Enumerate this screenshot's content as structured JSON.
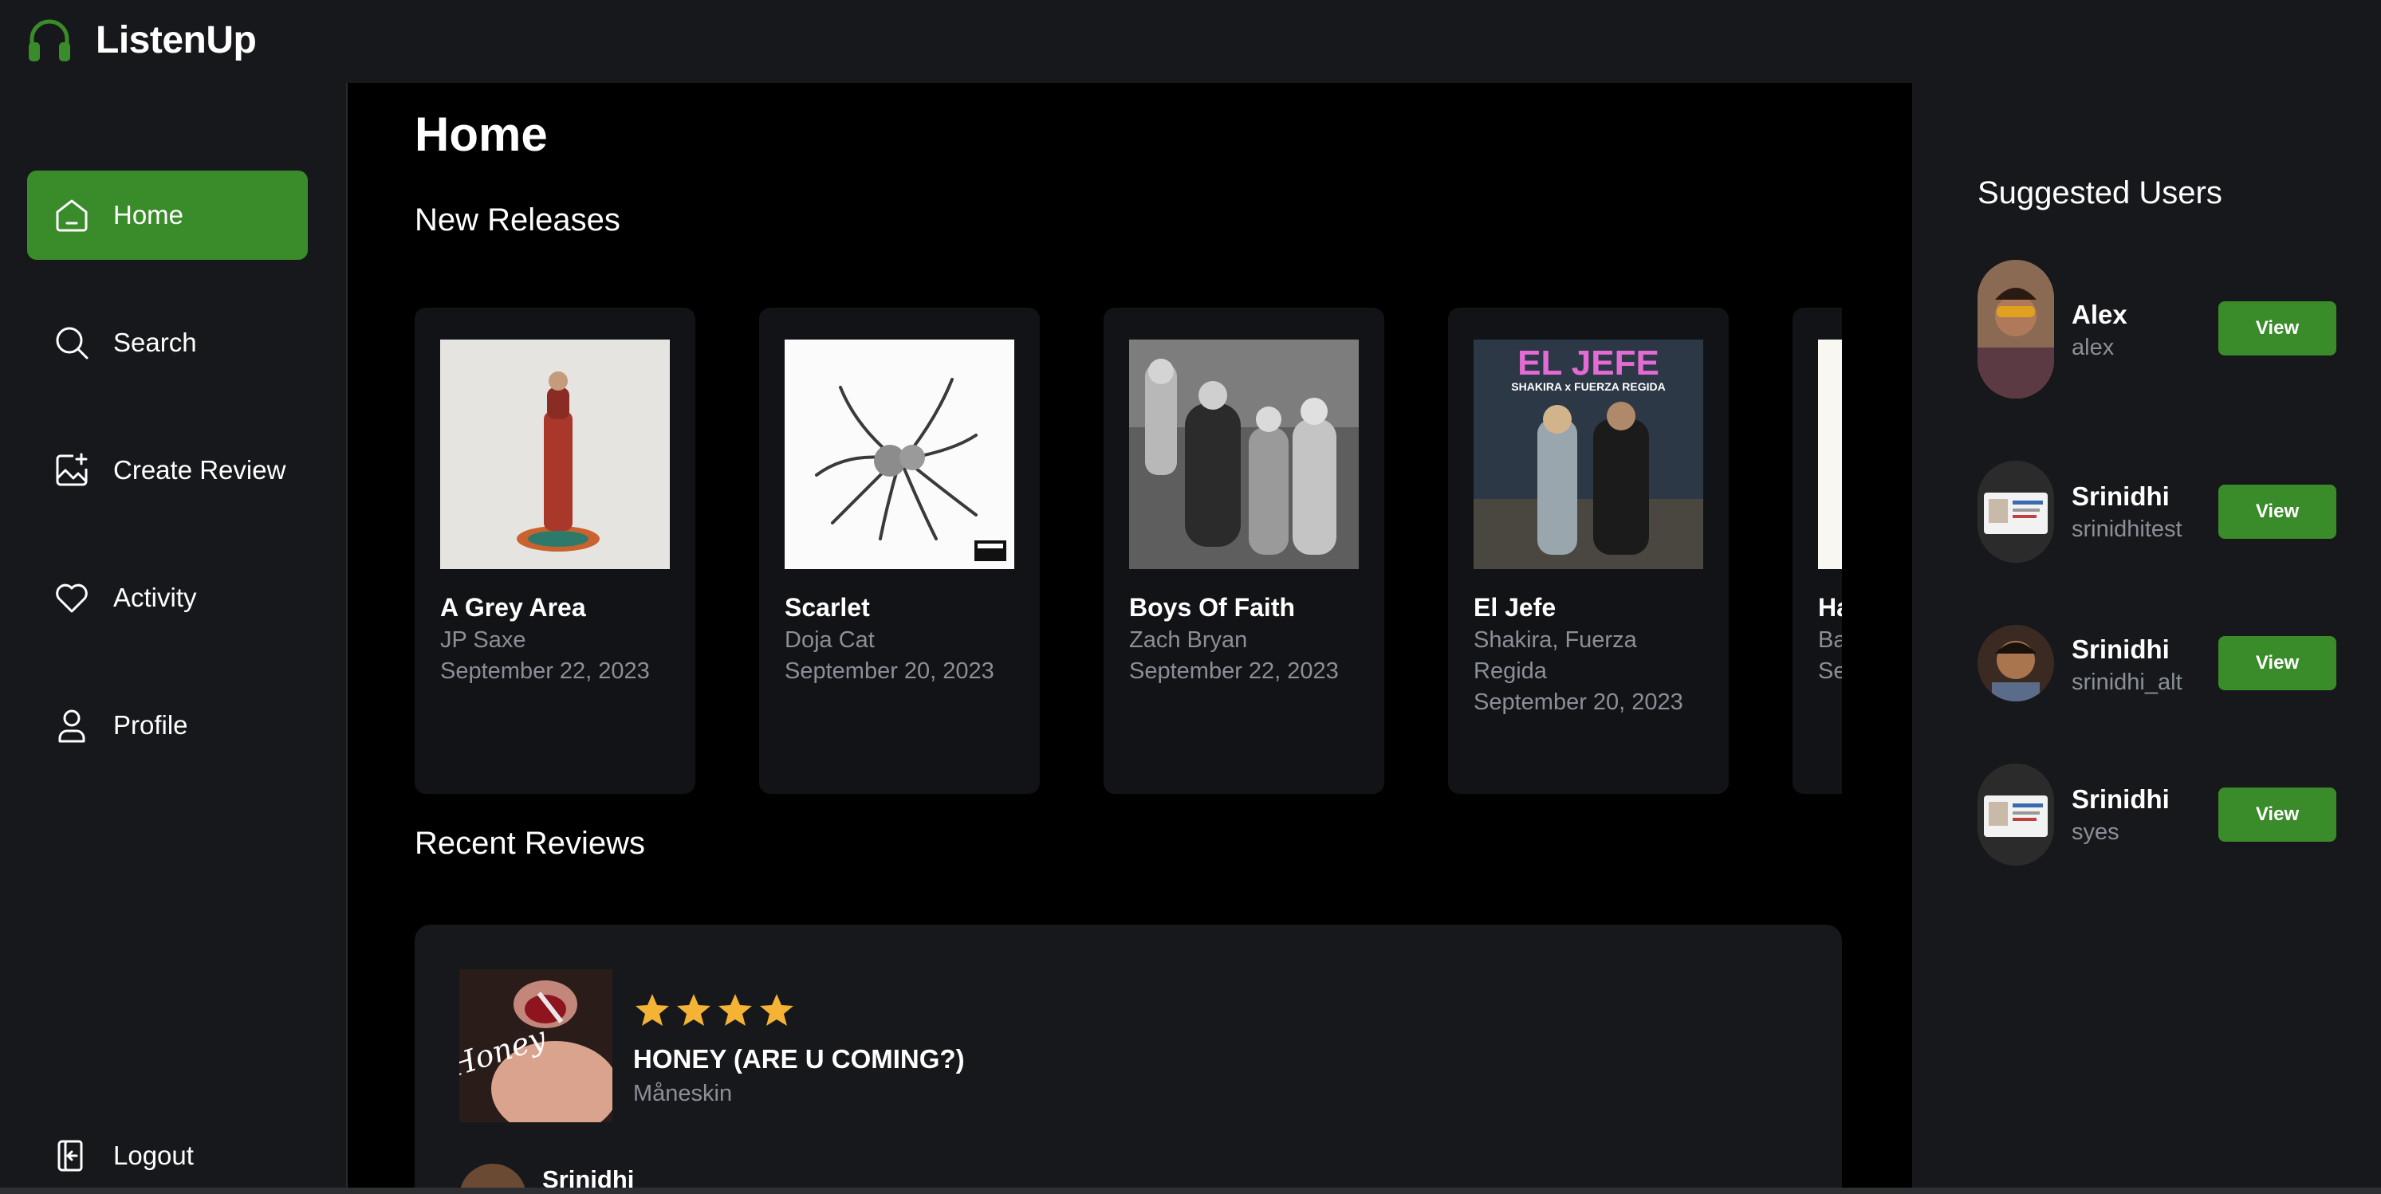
{
  "app": {
    "name": "ListenUp",
    "accent": "#3a8b2a"
  },
  "nav": {
    "items": [
      {
        "label": "Home",
        "icon": "home-icon",
        "active": true
      },
      {
        "label": "Search",
        "icon": "search-icon",
        "active": false
      },
      {
        "label": "Create Review",
        "icon": "image-add-icon",
        "active": false
      },
      {
        "label": "Activity",
        "icon": "heart-icon",
        "active": false
      },
      {
        "label": "Profile",
        "icon": "user-icon",
        "active": false
      }
    ],
    "logout": "Logout"
  },
  "main": {
    "title": "Home",
    "new_releases_title": "New Releases",
    "releases": [
      {
        "title": "A Grey Area",
        "artist": "JP Saxe",
        "date": "September 22, 2023"
      },
      {
        "title": "Scarlet",
        "artist": "Doja Cat",
        "date": "September 20, 2023"
      },
      {
        "title": "Boys Of Faith",
        "artist": "Zach Bryan",
        "date": "September 22, 2023"
      },
      {
        "title": "El Jefe",
        "artist": "Shakira, Fuerza Regida",
        "date": "September 20, 2023"
      },
      {
        "title": "Ha",
        "artist": "Ba",
        "date": "Se"
      }
    ],
    "el_jefe_cover_text": {
      "top": "EL JEFE",
      "sub": "SHAKIRA x FUERZA REGIDA"
    },
    "recent_reviews_title": "Recent Reviews",
    "review": {
      "rating": 4,
      "song": "HONEY (ARE U COMING?)",
      "artist": "Måneskin",
      "user": "Srinidhi",
      "cover_text": "Honey"
    }
  },
  "suggested": {
    "title": "Suggested Users",
    "button_label": "View",
    "users": [
      {
        "name": "Alex",
        "handle": "alex"
      },
      {
        "name": "Srinidhi",
        "handle": "srinidhitest"
      },
      {
        "name": "Srinidhi",
        "handle": "srinidhi_alt"
      },
      {
        "name": "Srinidhi",
        "handle": "syes"
      }
    ]
  }
}
